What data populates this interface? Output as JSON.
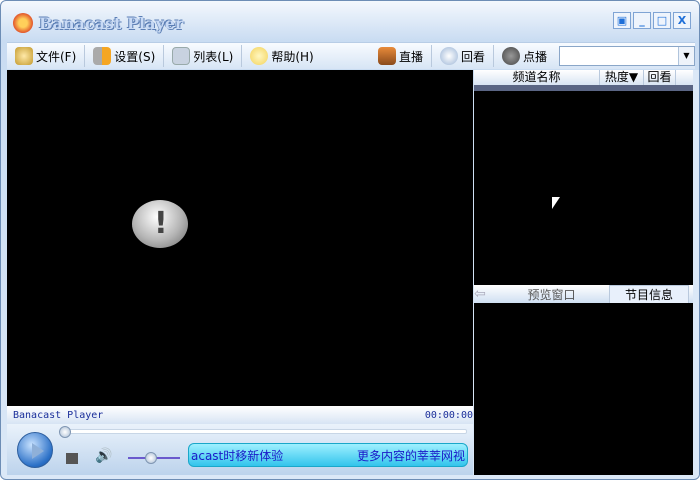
{
  "window": {
    "title": "Banacast Player",
    "buttons": [
      "▣",
      "_",
      "□",
      "X"
    ]
  },
  "menu": {
    "file": "文件(F)",
    "settings": "设置(S)",
    "list": "列表(L)",
    "help": "帮助(H)",
    "live": "直播",
    "replay": "回看",
    "vod": "点播",
    "search_value": ""
  },
  "channel_list": {
    "columns": [
      "频道名称",
      "热度▼",
      "回看"
    ]
  },
  "preview": {
    "tabs": [
      "预览窗口",
      "节目信息"
    ]
  },
  "status": {
    "title": "Banacast Player",
    "time": "00:00:00"
  },
  "ticker": {
    "left": "acast时移新体验",
    "right": "更多内容的莘莘网视"
  },
  "playback": {
    "position": 0,
    "volume": 0.45
  }
}
